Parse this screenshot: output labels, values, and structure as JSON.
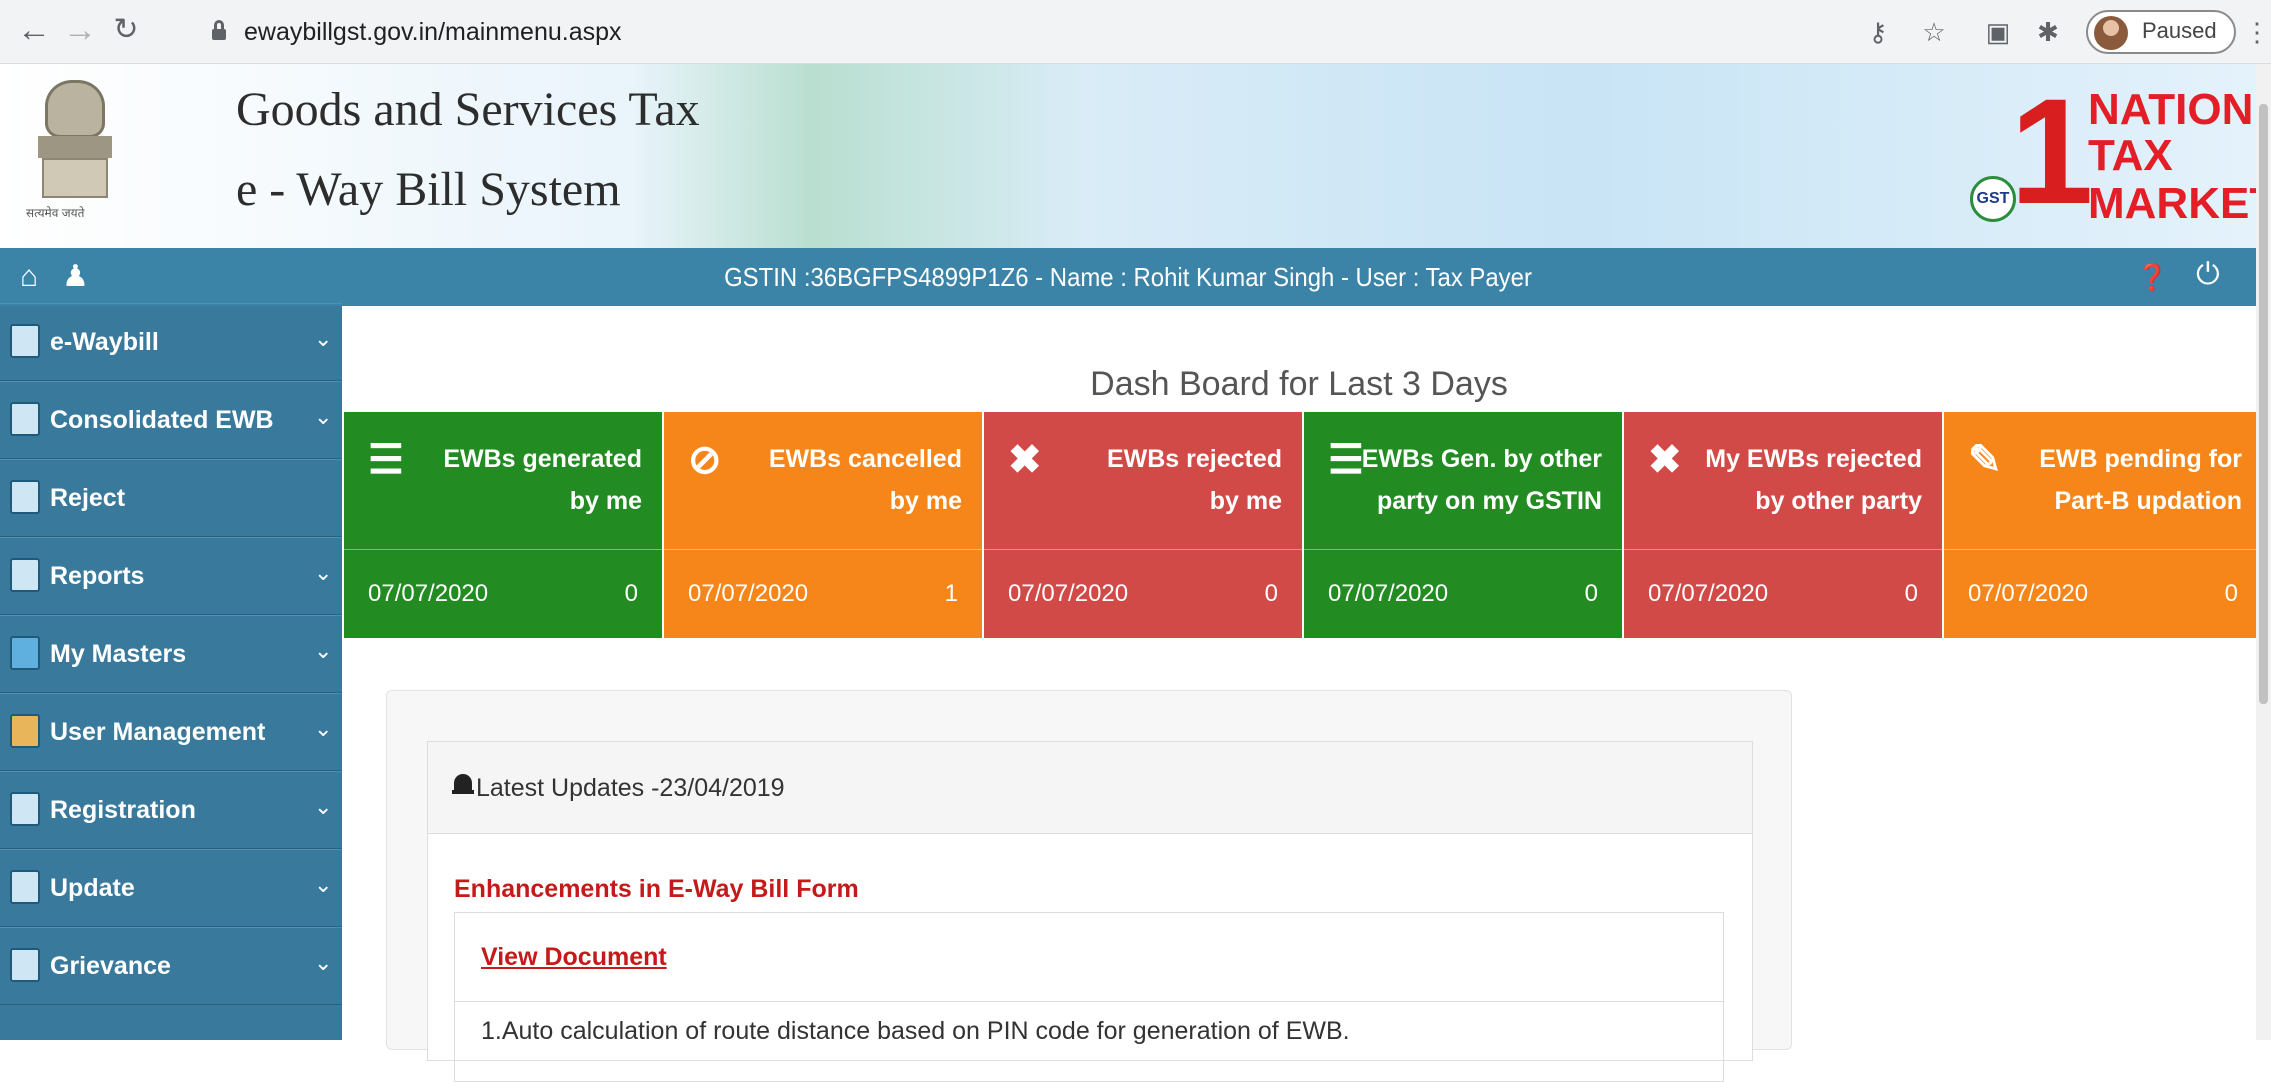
{
  "browser": {
    "url": "ewaybillgst.gov.in/mainmenu.aspx",
    "profile_status": "Paused",
    "icons": [
      "back-icon",
      "forward-icon",
      "reload-icon",
      "lock-icon",
      "key-icon",
      "star-icon",
      "extension-icon",
      "puzzle-icon",
      "menu-icon"
    ]
  },
  "header": {
    "emblem_motto": "सत्यमेव जयते",
    "title_line1": "Goods and Services Tax",
    "title_line2": "e - Way Bill System",
    "logo": {
      "digit": "1",
      "word1": "NATION",
      "word2": "TAX",
      "word3": "MARKET",
      "badge": "GST"
    }
  },
  "topbar": {
    "gstin_info": "GSTIN :36BGFPS4899P1Z6 - Name : Rohit Kumar Singh - User : Tax Payer"
  },
  "sidebar": {
    "items": [
      {
        "label": "e-Waybill",
        "icon": "document-icon",
        "chevron": true
      },
      {
        "label": "Consolidated EWB",
        "icon": "clipboard-icon",
        "chevron": true
      },
      {
        "label": "Reject",
        "icon": "reject-doc-icon",
        "chevron": false
      },
      {
        "label": "Reports",
        "icon": "report-icon",
        "chevron": true
      },
      {
        "label": "My Masters",
        "icon": "masters-icon",
        "chevron": true
      },
      {
        "label": "User Management",
        "icon": "users-icon",
        "chevron": true
      },
      {
        "label": "Registration",
        "icon": "registration-icon",
        "chevron": true
      },
      {
        "label": "Update",
        "icon": "update-icon",
        "chevron": true
      },
      {
        "label": "Grievance",
        "icon": "grievance-icon",
        "chevron": true
      }
    ]
  },
  "dashboard": {
    "title": "Dash Board for Last 3 Days",
    "cards": [
      {
        "title": "EWBs generated\nby me",
        "date": "07/07/2020",
        "count": "0",
        "color": "#228b22",
        "icon": "list-icon"
      },
      {
        "title": "EWBs cancelled\nby me",
        "date": "07/07/2020",
        "count": "1",
        "color": "#f7861a",
        "icon": "ban-icon"
      },
      {
        "title": "EWBs rejected\nby me",
        "date": "07/07/2020",
        "count": "0",
        "color": "#d24a47",
        "icon": "x-icon"
      },
      {
        "title": "EWBs Gen. by other\nparty on my GSTIN",
        "date": "07/07/2020",
        "count": "0",
        "color": "#228b22",
        "icon": "list-icon"
      },
      {
        "title": "My EWBs rejected\nby other party",
        "date": "07/07/2020",
        "count": "0",
        "color": "#d24a47",
        "icon": "x-icon"
      },
      {
        "title": "EWB pending for\nPart-B updation",
        "date": "07/07/2020",
        "count": "0",
        "color": "#f7861a",
        "icon": "edit-icon"
      }
    ]
  },
  "updates": {
    "header": "Latest Updates -23/04/2019",
    "subtitle": "Enhancements in E-Way Bill Form",
    "link": "View Document",
    "first_item": "1.Auto calculation of route distance based on PIN code for generation of EWB."
  }
}
